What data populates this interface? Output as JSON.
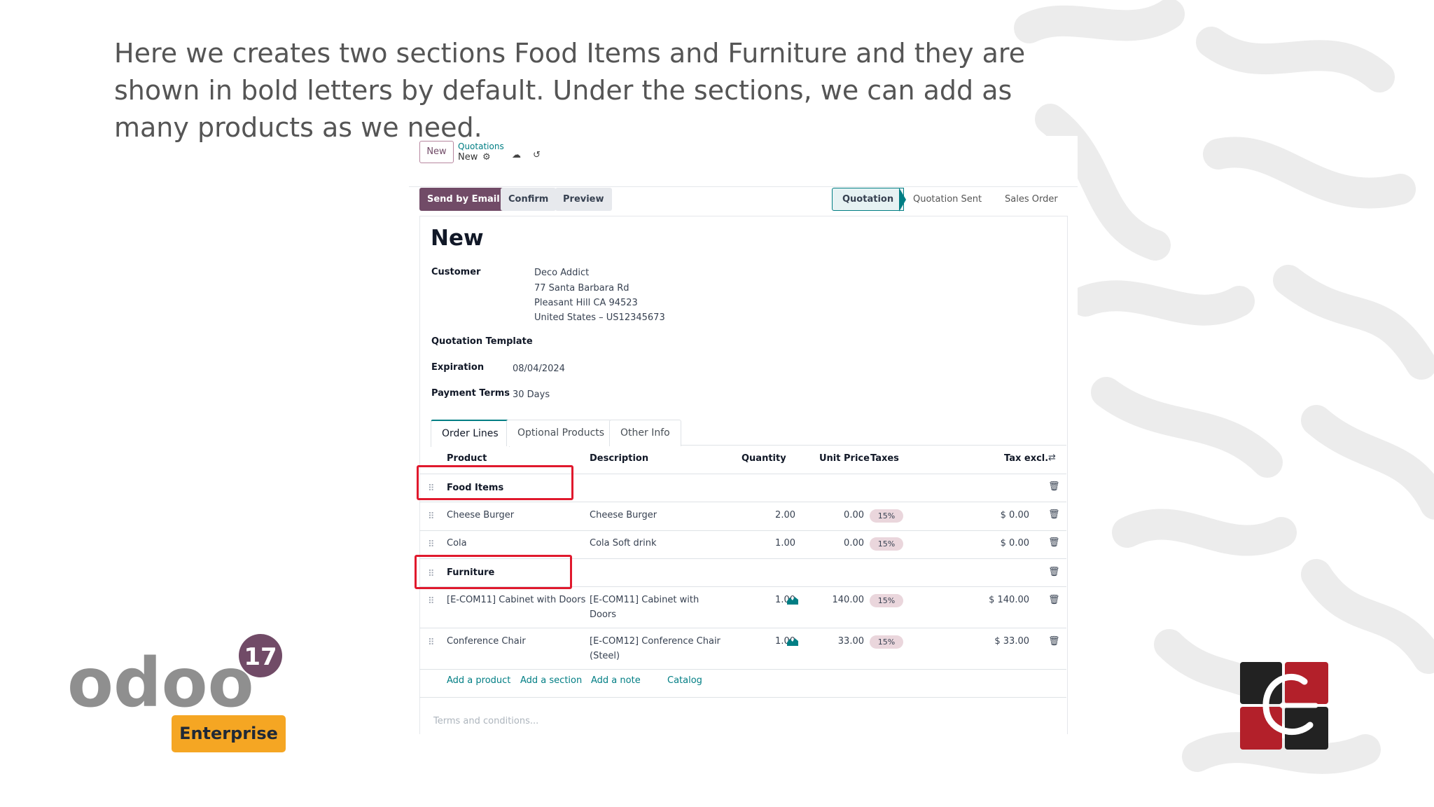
{
  "caption": "Here we creates two sections Food Items and Furniture and they are shown in bold letters by default. Under the sections, we can add as many products as we need.",
  "breadcrumb": {
    "new_button": "New",
    "parent": "Quotations",
    "current": "New"
  },
  "actions": {
    "send_email": "Send by Email",
    "confirm": "Confirm",
    "preview": "Preview"
  },
  "stages": [
    "Quotation",
    "Quotation Sent",
    "Sales Order"
  ],
  "record_title": "New",
  "fields": {
    "customer_label": "Customer",
    "customer_lines": [
      "Deco Addict",
      "77 Santa Barbara Rd",
      "Pleasant Hill CA 94523",
      "United States – US12345673"
    ],
    "template_label": "Quotation Template",
    "expiration_label": "Expiration",
    "expiration_value": "08/04/2024",
    "payment_label": "Payment Terms",
    "payment_value": "30 Days"
  },
  "tabs": [
    "Order Lines",
    "Optional Products",
    "Other Info"
  ],
  "columns": {
    "product": "Product",
    "description": "Description",
    "quantity": "Quantity",
    "unit_price": "Unit Price",
    "taxes": "Taxes",
    "tax_excl": "Tax excl."
  },
  "lines": [
    {
      "section": "Food Items"
    },
    {
      "product": "Cheese Burger",
      "description": [
        "Cheese Burger"
      ],
      "quantity": "2.00",
      "unit_price": "0.00",
      "tax": "15%",
      "subtotal": "$ 0.00"
    },
    {
      "product": "Cola",
      "description": [
        "Cola Soft drink"
      ],
      "quantity": "1.00",
      "unit_price": "0.00",
      "tax": "15%",
      "subtotal": "$ 0.00"
    },
    {
      "section": "Furniture"
    },
    {
      "product": "[E-COM11] Cabinet with Doors",
      "description": [
        "[E-COM11] Cabinet with",
        "Doors"
      ],
      "quantity": "1.00",
      "unit_price": "140.00",
      "tax": "15%",
      "subtotal": "$ 140.00"
    },
    {
      "product": "Conference Chair",
      "description": [
        "[E-COM12] Conference Chair",
        "(Steel)"
      ],
      "quantity": "1.00",
      "unit_price": "33.00",
      "tax": "15%",
      "subtotal": "$ 33.00"
    }
  ],
  "add_links": {
    "product": "Add a product",
    "section": "Add a section",
    "note": "Add a note",
    "catalog": "Catalog"
  },
  "terms_placeholder": "Terms and conditions...",
  "branding": {
    "product_wordmark": "odoo",
    "version": "17",
    "edition": "Enterprise"
  },
  "colors": {
    "primary": "#714b67",
    "accent": "#017e84",
    "highlight": "#e0192d",
    "badge": "#f5a623"
  },
  "icons": {
    "settings": "gear-icon",
    "save": "cloud-upload-icon",
    "discard": "undo-icon",
    "drag": "drag-handle-icon",
    "delete": "trash-icon",
    "forecast": "chart-icon",
    "columns": "adjust-columns-icon"
  }
}
